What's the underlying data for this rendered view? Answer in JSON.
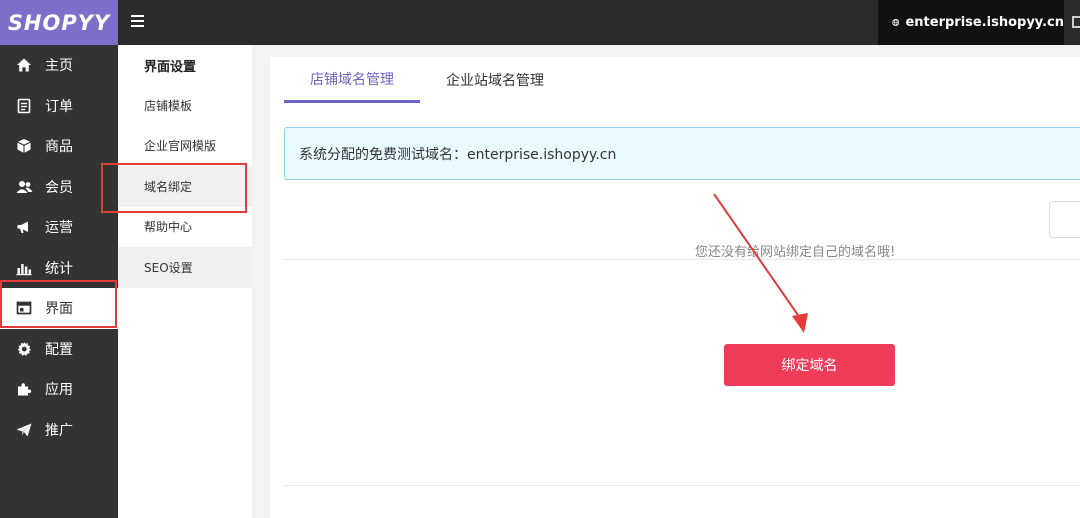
{
  "brand": {
    "logo": "SHOPYY"
  },
  "topbar": {
    "domain": "enterprise.ishopyy.cn"
  },
  "sidenav": {
    "items": [
      {
        "label": "主页",
        "icon": "home-icon"
      },
      {
        "label": "订单",
        "icon": "order-icon"
      },
      {
        "label": "商品",
        "icon": "product-icon"
      },
      {
        "label": "会员",
        "icon": "member-icon"
      },
      {
        "label": "运营",
        "icon": "megaphone-icon"
      },
      {
        "label": "统计",
        "icon": "chart-icon"
      },
      {
        "label": "界面",
        "icon": "interface-icon"
      },
      {
        "label": "配置",
        "icon": "gear-icon"
      },
      {
        "label": "应用",
        "icon": "puzzle-icon"
      },
      {
        "label": "推广",
        "icon": "paper-plane-icon"
      }
    ],
    "active_index": 6
  },
  "subnav": {
    "title": "界面设置",
    "items": [
      {
        "label": "店铺模板"
      },
      {
        "label": "企业官网模版"
      },
      {
        "label": "域名绑定"
      },
      {
        "label": "帮助中心"
      },
      {
        "label": "SEO设置"
      }
    ]
  },
  "main": {
    "tabs": [
      {
        "label": "店铺域名管理"
      },
      {
        "label": "企业站域名管理"
      }
    ],
    "alert_text": "系统分配的免费测试域名：enterprise.ishopyy.cn",
    "empty_text": "您还没有给网站绑定自己的域名哦!",
    "bind_button": "绑定域名"
  },
  "colors": {
    "brand": "#7b6fc9",
    "accent": "#ef3d59",
    "highlight": "#e53b3b"
  }
}
